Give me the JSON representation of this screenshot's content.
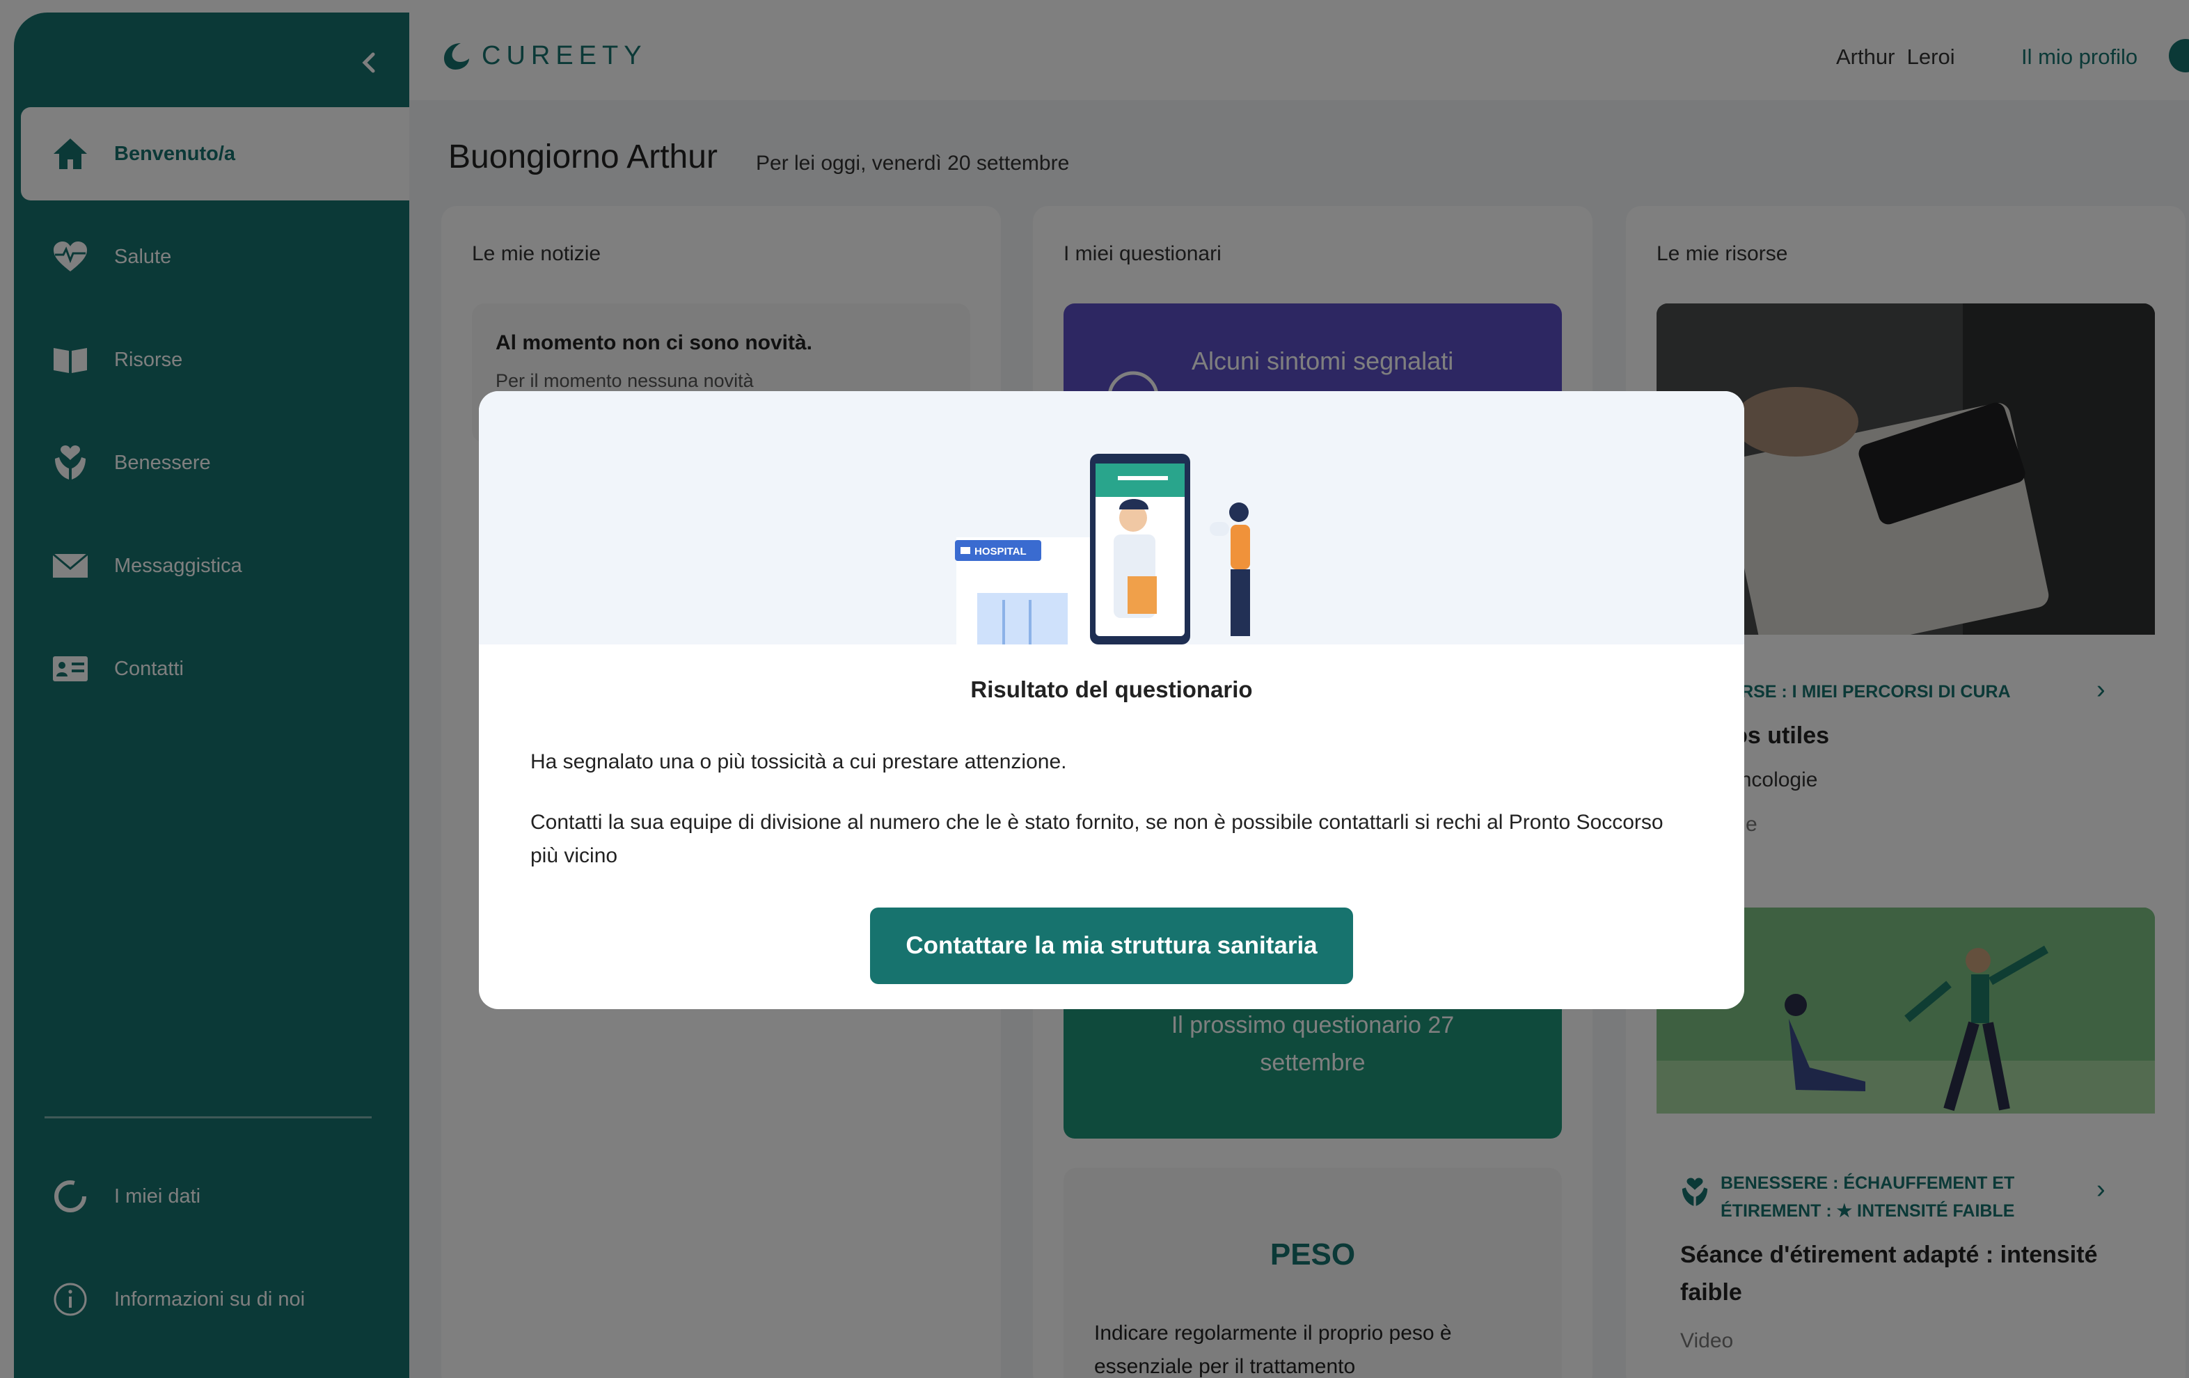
{
  "app": {
    "logo_text": "CUREETY"
  },
  "header": {
    "user_first": "Arthur",
    "user_last": "Leroi",
    "profile_link": "Il mio profilo"
  },
  "sidebar": {
    "items": [
      {
        "label": "Benvenuto/a",
        "icon": "home-icon",
        "active": true
      },
      {
        "label": "Salute",
        "icon": "heart-pulse-icon"
      },
      {
        "label": "Risorse",
        "icon": "book-icon"
      },
      {
        "label": "Benessere",
        "icon": "heart-hands-icon"
      },
      {
        "label": "Messaggistica",
        "icon": "mail-icon"
      },
      {
        "label": "Contatti",
        "icon": "contact-card-icon"
      }
    ],
    "bottom_items": [
      {
        "label": "I miei dati",
        "icon": "loading-ring-icon"
      },
      {
        "label": "Informazioni su di noi",
        "icon": "info-icon"
      }
    ]
  },
  "main": {
    "greeting": "Buongiorno Arthur",
    "date": "Per lei oggi, venerdì 20 settembre",
    "news": {
      "title": "Le mie notizie",
      "card_title": "Al momento non ci sono novità.",
      "card_text": "Per il momento nessuna novità"
    },
    "questionnaires": {
      "title": "I miei questionari",
      "symptom_card": "Alcuni sintomi segnalati",
      "next_line1": "Il prossimo questionario 27",
      "next_line2": "settembre",
      "peso_title": "PESO",
      "peso_desc": "Indicare regolarmente il proprio peso è essenziale per il trattamento"
    },
    "resources": {
      "title": "Le mie risorse",
      "card1_subtitle": "ISORSE : I MIEI PERCORSI DI CURA",
      "card1_title": "éros utiles",
      "card1_line1": "e oncologie",
      "card1_line2": "page",
      "card2_subtitle": "BENESSERE : ÉCHAUFFEMENT ET ÉTIREMENT : ★ INTENSITÉ FAIBLE",
      "card2_title": "Séance d'étirement adapté : intensité faible",
      "card2_type": "Video"
    }
  },
  "modal": {
    "illustration_label": "HOSPITAL",
    "title": "Risultato del questionario",
    "p1": "Ha segnalato una o più tossicità a cui prestare attenzione.",
    "p2": "Contatti la sua equipe di divisione al numero che le è stato fornito, se non è possibile contattarli si rechi al Pronto Soccorso più vicino",
    "button": "Contattare la mia struttura sanitaria"
  },
  "colors": {
    "brand": "#17736e",
    "purple": "#5a4fc4",
    "green": "#1f9478",
    "overlay": "rgba(0,0,0,0.5)"
  }
}
